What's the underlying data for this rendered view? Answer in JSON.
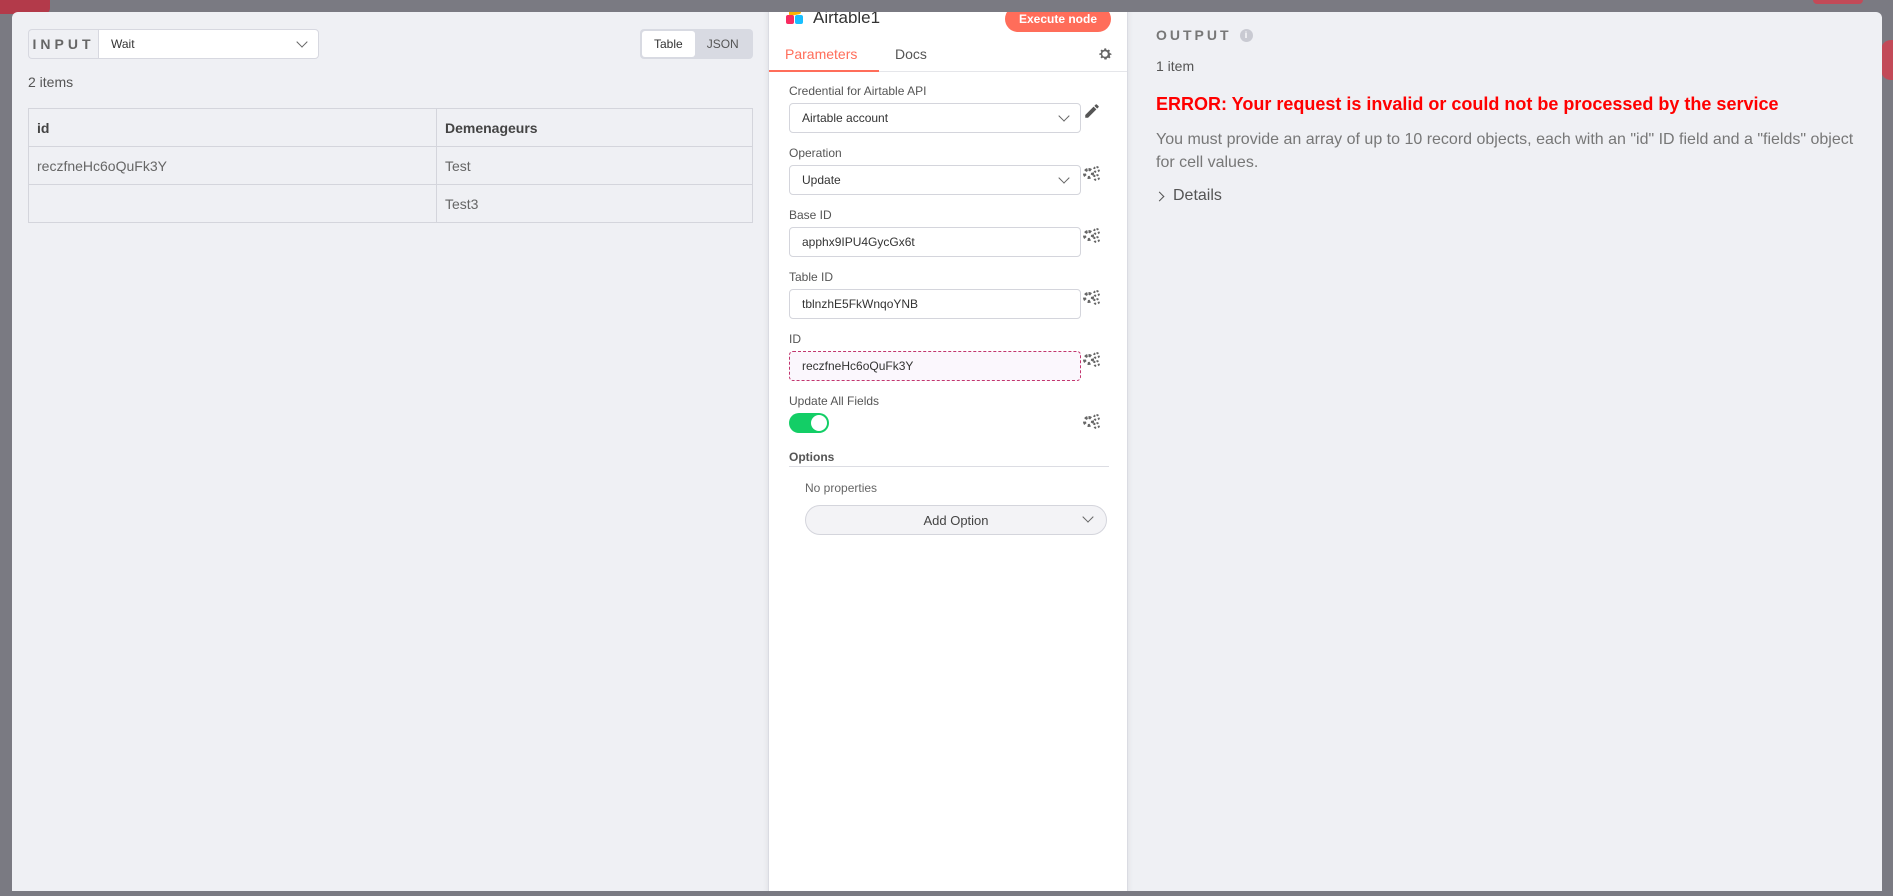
{
  "input": {
    "label": "INPUT",
    "selected_node": "Wait",
    "view_options": [
      "Table",
      "JSON"
    ],
    "active_view": "Table",
    "items_count": "2 items",
    "table": {
      "headers": [
        "id",
        "Demenageurs"
      ],
      "rows": [
        [
          "reczfneHc6oQuFk3Y",
          "Test"
        ],
        [
          "",
          "Test3"
        ]
      ]
    }
  },
  "node": {
    "name": "Airtable1",
    "execute_label": "Execute node",
    "tabs": [
      "Parameters",
      "Docs"
    ],
    "active_tab": "Parameters",
    "params": {
      "credential": {
        "label": "Credential for Airtable API",
        "value": "Airtable account"
      },
      "operation": {
        "label": "Operation",
        "value": "Update"
      },
      "base_id": {
        "label": "Base ID",
        "value": "apphx9IPU4GycGx6t"
      },
      "table_id": {
        "label": "Table ID",
        "value": "tblnzhE5FkWnqoYNB"
      },
      "id": {
        "label": "ID",
        "value": "reczfneHc6oQuFk3Y"
      },
      "update_all": {
        "label": "Update All Fields",
        "value": true
      }
    },
    "options": {
      "title": "Options",
      "empty": "No properties",
      "add_label": "Add Option"
    }
  },
  "output": {
    "label": "OUTPUT",
    "items_count": "1 item",
    "error_title": "ERROR: Your request is invalid or could not be processed by the service",
    "error_description": "You must provide an array of up to 10 record objects, each with an \"id\" ID field and a \"fields\" object for cell values.",
    "details_label": "Details"
  },
  "colors": {
    "accent": "#ff6d5a",
    "error": "#ff0000",
    "toggle_on": "#13ce66"
  }
}
